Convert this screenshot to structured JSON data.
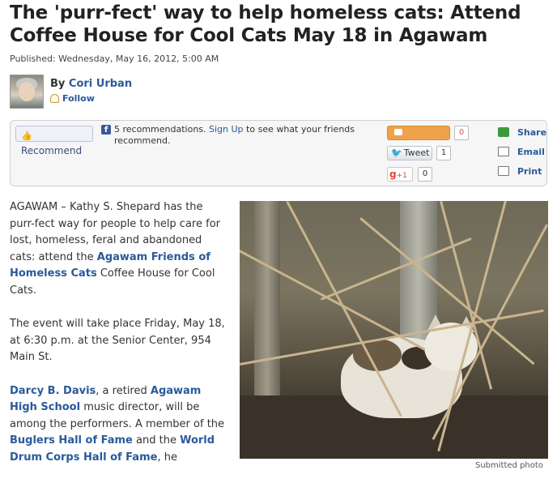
{
  "headline": "The 'purr-fect' way to help homeless cats: Attend Coffee House for Cool Cats May 18 in Agawam",
  "published": "Published: Wednesday, May 16, 2012, 5:00 AM",
  "author": {
    "by_label": "By",
    "name": "Cori Urban",
    "follow_label": "Follow"
  },
  "share_bar": {
    "recommend_label": "Recommend",
    "fb_count_text": "5 recommendations.",
    "signup_link": "Sign Up",
    "signup_rest": "to see what your friends recommend.",
    "comment_label": "Comment",
    "comment_count": "0",
    "tweet_label": "Tweet",
    "tweet_count": "1",
    "gplus_label": "+1",
    "gplus_count": "0",
    "share_label": "Share",
    "email_label": "Email",
    "print_label": "Print"
  },
  "article": {
    "p1_a": "AGAWAM – Kathy S. Shepard has the purr-fect way for people to help care for lost, homeless, feral and abandoned cats: attend the",
    "p1_link": "Agawam Friends of Homeless Cats",
    "p1_b": "Coffee House for Cool Cats.",
    "p2": "The event will take place Friday, May 18, at 6:30 p.m. at the Senior Center, 954 Main St.",
    "p3_link1": "Darcy B. Davis",
    "p3_a": ", a retired",
    "p3_link2": "Agawam High School",
    "p3_b": "music director, will be among the performers. A member of the",
    "p3_link3": "Buglers Hall of Fame",
    "p3_c": "and the",
    "p3_link4": "World Drum Corps Hall of Fame",
    "p3_d": ", he"
  },
  "photo_credit": "Submitted photo"
}
